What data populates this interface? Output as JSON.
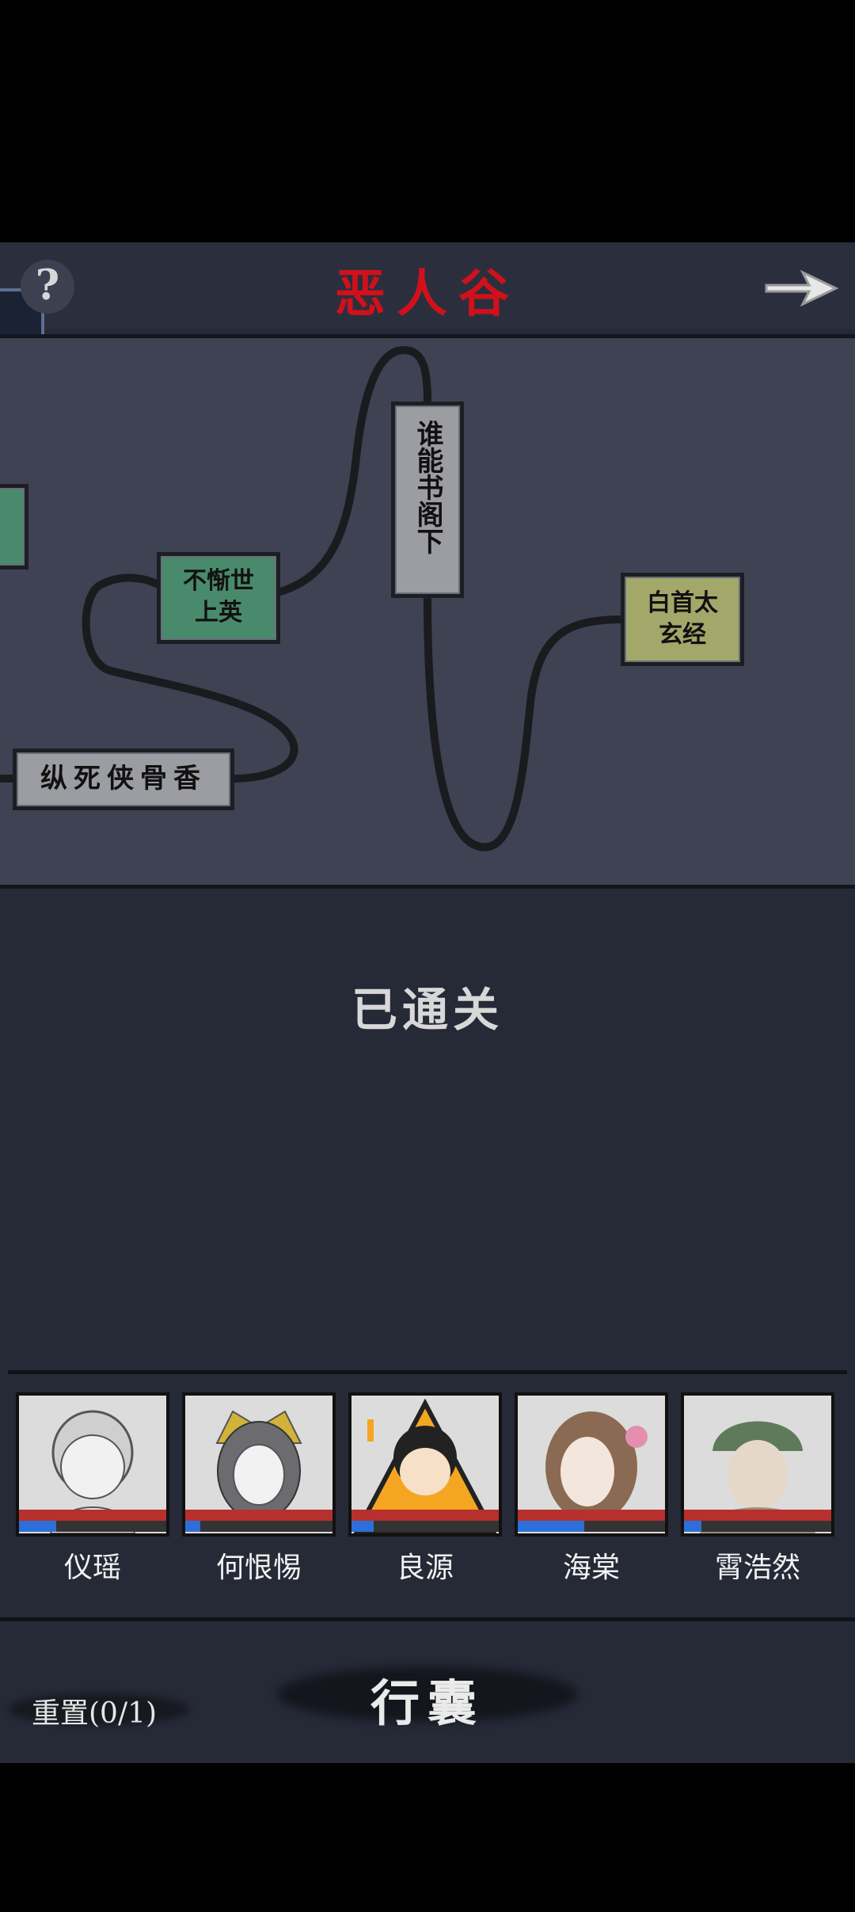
{
  "header": {
    "title": "恶人谷",
    "help_label": "?",
    "help_icon": "question-mark-icon",
    "next_icon": "arrow-right-icon"
  },
  "map": {
    "nodes": [
      {
        "label_line1": "不惭世",
        "label_line2": "上英",
        "color": "#4a8a6c"
      },
      {
        "label": "谁能书阁下",
        "color": "#9c9da2"
      },
      {
        "label_line1": "白首太",
        "label_line2": "玄经",
        "color": "#a3a86a"
      },
      {
        "label": "纵死侠骨香",
        "color": "#9c9da2"
      }
    ]
  },
  "status": {
    "text": "已通关"
  },
  "party": [
    {
      "name": "仪瑶",
      "hp": 1.0,
      "mp": 0.25
    },
    {
      "name": "何恨惕",
      "hp": 1.0,
      "mp": 0.1
    },
    {
      "name": "良源",
      "hp": 1.0,
      "mp": 0.15
    },
    {
      "name": "海棠",
      "hp": 1.0,
      "mp": 0.45
    },
    {
      "name": "霄浩然",
      "hp": 1.0,
      "mp": 0.12
    }
  ],
  "footer": {
    "bag_label": "行囊",
    "reset_label": "重置(0/1)"
  },
  "colors": {
    "title_red": "#d0111b",
    "hp_red": "#b7302e",
    "mp_blue": "#2d6fd8"
  }
}
